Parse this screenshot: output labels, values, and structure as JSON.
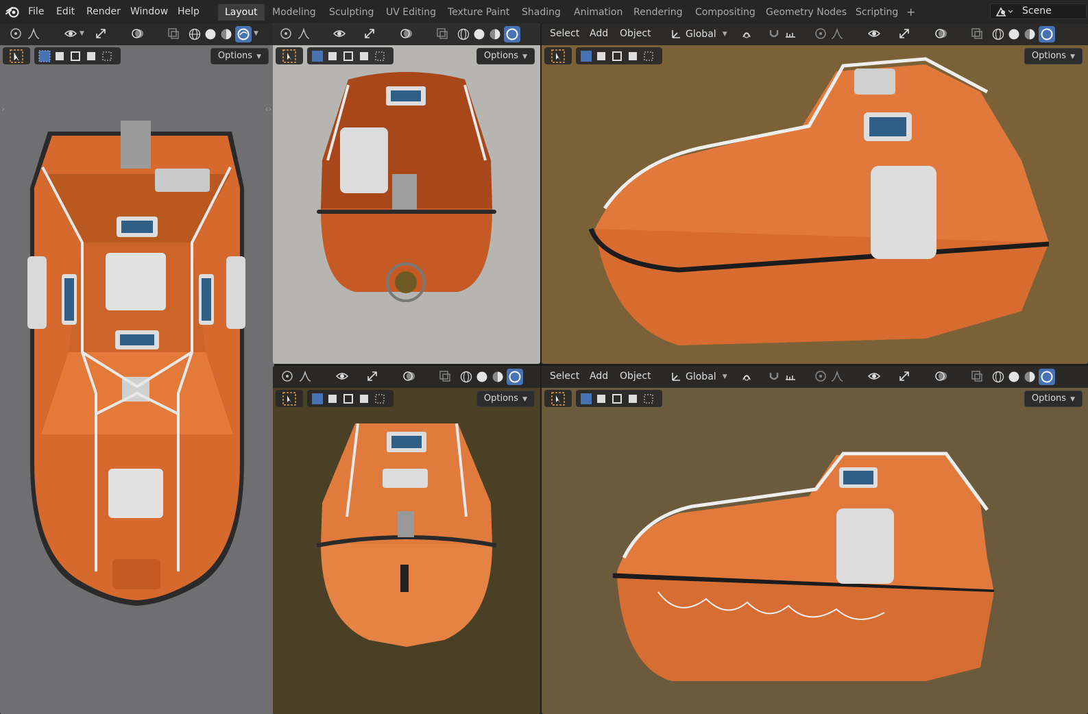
{
  "app": {
    "menus": [
      "File",
      "Edit",
      "Render",
      "Window",
      "Help"
    ],
    "workspaces": [
      "Layout",
      "Modeling",
      "Sculpting",
      "UV Editing",
      "Texture Paint",
      "Shading",
      "Animation",
      "Rendering",
      "Compositing",
      "Geometry Nodes",
      "Scripting"
    ],
    "active_workspace": "Layout",
    "add_workspace": "+",
    "scene": "Scene"
  },
  "viewport": {
    "menu_select": "Select",
    "menu_add": "Add",
    "menu_object": "Object",
    "transform_orientation": "Global",
    "options_label": "Options"
  },
  "icons": {
    "logo": "blender-logo-icon",
    "select_tool": "select-box-icon",
    "overlay": "overlay-icon",
    "gizmo": "gizmo-icon",
    "xray": "xray-icon",
    "shading_wire": "wireframe-shading-icon",
    "shading_solid": "solid-shading-icon",
    "shading_material": "material-preview-icon",
    "shading_rendered": "rendered-shading-icon"
  },
  "colors": {
    "hull": "#e27a3f",
    "accent_blue": "#4772b3",
    "bg_top": "#262626"
  }
}
